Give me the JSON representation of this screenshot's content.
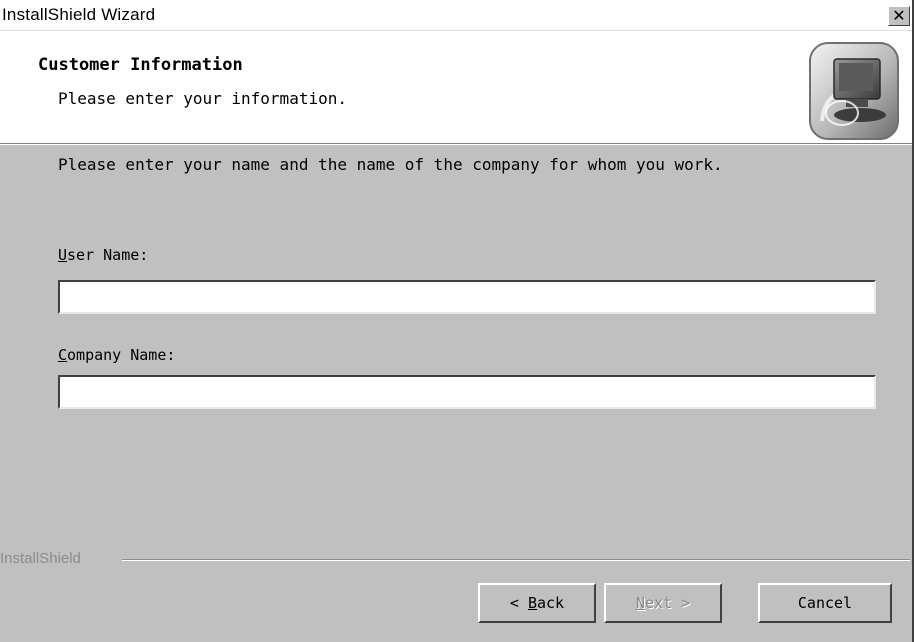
{
  "window": {
    "title": "InstallShield Wizard",
    "close_glyph": "✕"
  },
  "header": {
    "title": "Customer Information",
    "subtitle": "Please enter your information.",
    "icon": "computer-setup-icon"
  },
  "body": {
    "instruction": "Please enter your name and the name of the company for whom you work."
  },
  "fields": {
    "user_name": {
      "label_mnemonic": "U",
      "label_rest": "ser Name:",
      "value": ""
    },
    "company_name": {
      "label_mnemonic": "C",
      "label_rest": "ompany Name:",
      "value": ""
    }
  },
  "footer": {
    "brand": "InstallShield"
  },
  "buttons": {
    "back": {
      "prefix": "< ",
      "mnemonic": "B",
      "rest": "ack"
    },
    "next": {
      "mnemonic": "N",
      "rest": "ext >",
      "enabled": false
    },
    "cancel": {
      "label": "Cancel"
    }
  },
  "colors": {
    "dialog_bg": "#c0c0c0",
    "header_bg": "#ffffff",
    "disabled_text": "#888888"
  }
}
